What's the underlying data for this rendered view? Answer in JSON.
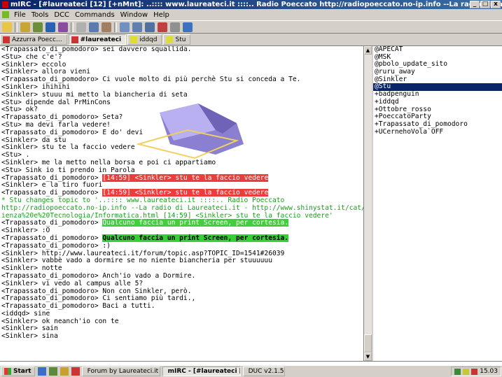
{
  "window": {
    "title": "mIRC - [#laureateci [12] [+nMnt]: ..:::: www.laureateci.it ::::.. Radio Poeccato http://radiopoeccato.no-ip.info --La radio di Laureateci.it - http://www]",
    "buttons": {
      "min": "_",
      "max": "□",
      "close": "x"
    }
  },
  "menu": [
    "File",
    "Tools",
    "DCC",
    "Commands",
    "Window",
    "Help"
  ],
  "switchbar": [
    {
      "label": "Azzurra Poecc...",
      "active": false,
      "color": "#c33"
    },
    {
      "label": "#laureateci",
      "active": true,
      "color": "#c33"
    },
    {
      "label": "iddqd",
      "active": false,
      "color": "#dd3"
    },
    {
      "label": "Stu",
      "active": false,
      "color": "#dd3"
    }
  ],
  "chat": [
    [
      {
        "t": "<Trapassato_di_pomodoro> sei davvero squallida."
      }
    ],
    [
      {
        "t": "<Stu> che c'e'?"
      }
    ],
    [
      {
        "t": "<Sinkler> eccolo"
      }
    ],
    [
      {
        "t": "<Sinkler> allora vieni"
      }
    ],
    [
      {
        "t": "<Trapassato_di_pomodoro> Ci vuole molto di più perchè Stu si conceda a Te."
      }
    ],
    [
      {
        "t": "<Sinkler> ihihihi"
      }
    ],
    [
      {
        "t": "<Sinkler> stuuu mi metto la biancheria di seta"
      }
    ],
    [
      {
        "t": "<Stu> dipende dal PrMinCons"
      }
    ],
    [
      {
        "t": "<Stu> ok?"
      }
    ],
    [
      {
        "t": "<Trapassato_di_pomodoro> Seta?"
      }
    ],
    [
      {
        "t": "<Stu> ma devi farla vedere!"
      }
    ],
    [
      {
        "t": "<Trapassato_di_pomodoro> E do' devi"
      }
    ],
    [
      {
        "t": "<Sinkler> da stu"
      }
    ],
    [
      {
        "t": "<Sinkler> stu te la faccio vedere"
      }
    ],
    [
      {
        "t": "<Stu> ."
      }
    ],
    [
      {
        "t": "<Sinkler> me la metto nella borsa e poi ci appartiamo"
      }
    ],
    [
      {
        "t": "<Stu> Sink io ti prendo in Parola"
      }
    ],
    [
      {
        "t": "<Trapassato_di_pomodoro> "
      },
      {
        "t": "[14:59] <Sinkler> stu te la faccio vedere",
        "c": "hl-red"
      }
    ],
    [
      {
        "t": "<Sinkler> e la tiro fuori"
      }
    ],
    [
      {
        "t": "<Trapassato_di_pomodoro> "
      },
      {
        "t": "[14:59] <Sinkler> stu te la faccio vedere",
        "c": "hl-red"
      }
    ],
    [
      {
        "t": "* Stu changes topic to '..:::: www.laureateci.it ::::.. Radio Poeccato",
        "c": "topic"
      }
    ],
    [
      {
        "t": "http://radiopoeccato.no-ip.info --La radio di Laureateci.it - http://www.shinystat.it/cat/Sc",
        "c": "topic"
      }
    ],
    [
      {
        "t": "ienza%20e%20Tecnologia/Informatica.html [14:59] <Sinkler> stu te la faccio vedere'",
        "c": "topic"
      }
    ],
    [
      {
        "t": "<Trapassato_di_pomodoro> "
      },
      {
        "t": "Qualcuno faccia un print Screen, per cortesia.",
        "c": "hl-green"
      }
    ],
    [
      {
        "t": "<Sinkler> :O"
      }
    ],
    [
      {
        "t": "<Trapassato_di_pomodoro> "
      },
      {
        "t": "Qualcuno faccia un print Screen, per cortesia.",
        "c": "hl-green-bold"
      }
    ],
    [
      {
        "t": "<Trapassato_di_pomodoro> :)"
      }
    ],
    [
      {
        "t": "<Sinkler> http://www.laureateci.it/forum/topic.asp?TOPIC_ID=1541#26039"
      }
    ],
    [
      {
        "t": "<Sinkler> vabbè vado a dormire se no niente biancheria per stuuuuuu"
      }
    ],
    [
      {
        "t": "<Sinkler> notte"
      }
    ],
    [
      {
        "t": "<Trapassato_di_pomodoro> Anch'io vado a Dormire."
      }
    ],
    [
      {
        "t": "<Sinkler> vi vedo al campus alle 5?"
      }
    ],
    [
      {
        "t": "<Trapassato_di_pomodoro> Non con Sinkler, però."
      }
    ],
    [
      {
        "t": "<Trapassato_di_pomodoro> Ci sentiamo più tardi.,"
      }
    ],
    [
      {
        "t": "<Trapassato_di_pomodoro> Baci a tutti."
      }
    ],
    [
      {
        "t": "<iddqd> sine"
      }
    ],
    [
      {
        "t": "<Sinkler> ok neanch'io con te"
      }
    ],
    [
      {
        "t": "<Sinkler> sain"
      }
    ],
    [
      {
        "t": "<Sinkler> sina"
      }
    ]
  ],
  "nicklist": [
    {
      "nick": "@APECAT",
      "selected": false
    },
    {
      "nick": "@MSK",
      "selected": false
    },
    {
      "nick": "@pbolo_update_sito",
      "selected": false
    },
    {
      "nick": "@ruru_away",
      "selected": false
    },
    {
      "nick": "@Sinkler",
      "selected": false
    },
    {
      "nick": "@Stu",
      "selected": true
    },
    {
      "nick": "+badpenguin",
      "selected": false
    },
    {
      "nick": "+iddqd",
      "selected": false
    },
    {
      "nick": "+Ottobre_rosso",
      "selected": false
    },
    {
      "nick": "+PoeccatoParty",
      "selected": false
    },
    {
      "nick": "+Trapassato_di_pomodoro",
      "selected": false
    },
    {
      "nick": "+UCernehoVola`OFF",
      "selected": false
    }
  ],
  "taskbar": {
    "start": "Start",
    "tasks": [
      {
        "label": "Forum by Laureateci.it - Mi...",
        "active": false,
        "color": "#2a64c8"
      },
      {
        "label": "mIRC - [#laureateci [12] ...",
        "active": true,
        "color": "#c33"
      },
      {
        "label": "DUC v2.1.5",
        "active": false,
        "color": "#c33"
      }
    ],
    "clock": "15.03"
  }
}
